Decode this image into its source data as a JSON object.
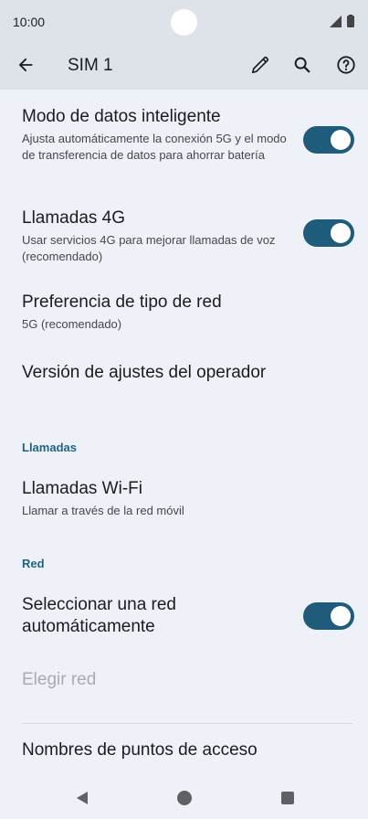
{
  "status_bar": {
    "time": "10:00"
  },
  "app_bar": {
    "title": "SIM 1"
  },
  "items": {
    "smart_data": {
      "title": "Modo de datos inteligente",
      "subtitle": "Ajusta automáticamente la conexión 5G y el modo de transferencia de datos para ahorrar batería",
      "toggle_on": true
    },
    "calls_4g": {
      "title": "Llamadas 4G",
      "subtitle": "Usar servicios 4G para mejorar llamadas de voz (recomendado)",
      "toggle_on": true
    },
    "network_type": {
      "title": "Preferencia de tipo de red",
      "subtitle": "5G (recomendado)"
    },
    "carrier_version": {
      "title": "Versión de ajustes del operador"
    },
    "wifi_calls": {
      "title": "Llamadas Wi-Fi",
      "subtitle": "Llamar a través de la red móvil"
    },
    "auto_network": {
      "title": "Seleccionar una red automáticamente",
      "toggle_on": true
    },
    "choose_network": {
      "title": "Elegir red"
    },
    "apn": {
      "title": "Nombres de puntos de acceso"
    }
  },
  "sections": {
    "calls": "Llamadas",
    "network": "Red"
  },
  "colors": {
    "accent": "#1f5c7c",
    "section_header": "#1f6383",
    "background": "#eff1f8",
    "app_bar": "#dee3ea"
  }
}
